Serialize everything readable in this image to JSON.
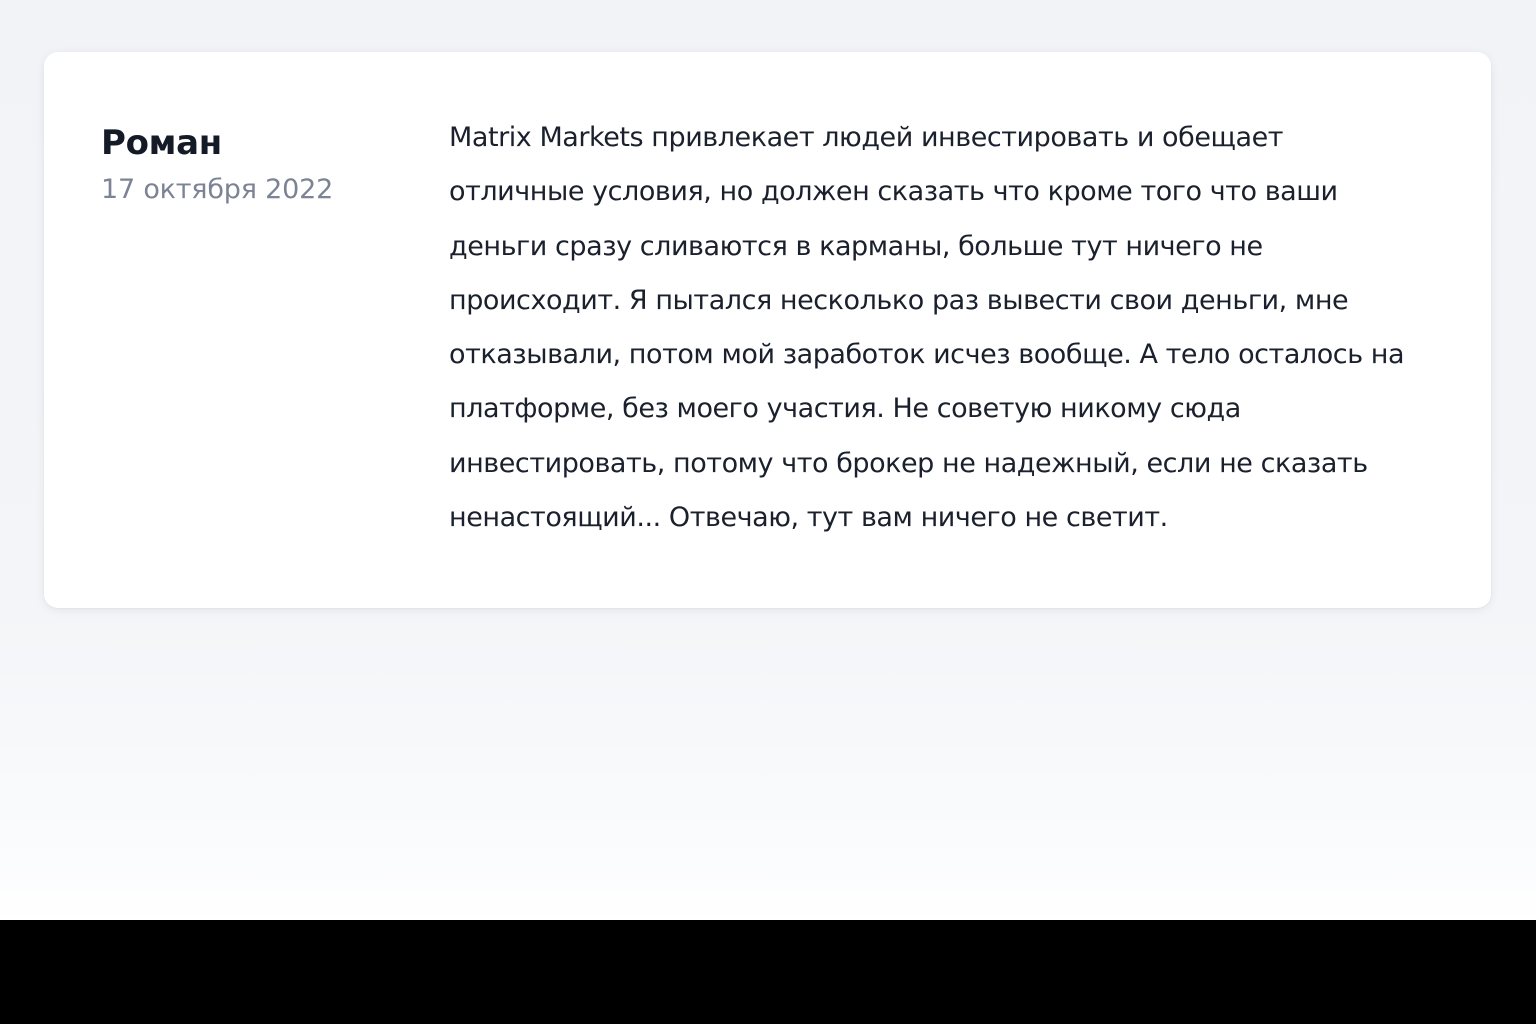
{
  "review": {
    "author": "Роман",
    "date": "17 октября 2022",
    "text_lines": [
      "Matrix Markets привлекает людей инвестировать и обещает",
      "отличные условия, но должен сказать что кроме того что ваши",
      "деньги сразу сливаются в карманы, больше тут ничего не",
      "происходит. Я пытался несколько раз вывести свои деньги, мне",
      "отказывали, потом мой заработок исчез вообще. А тело осталось на",
      "платформе, без моего участия. Не советую никому сюда",
      "инвестировать, потому что брокер не надежный, если не сказать",
      "ненастоящий... Отвечаю, тут вам ничего не светит."
    ]
  }
}
